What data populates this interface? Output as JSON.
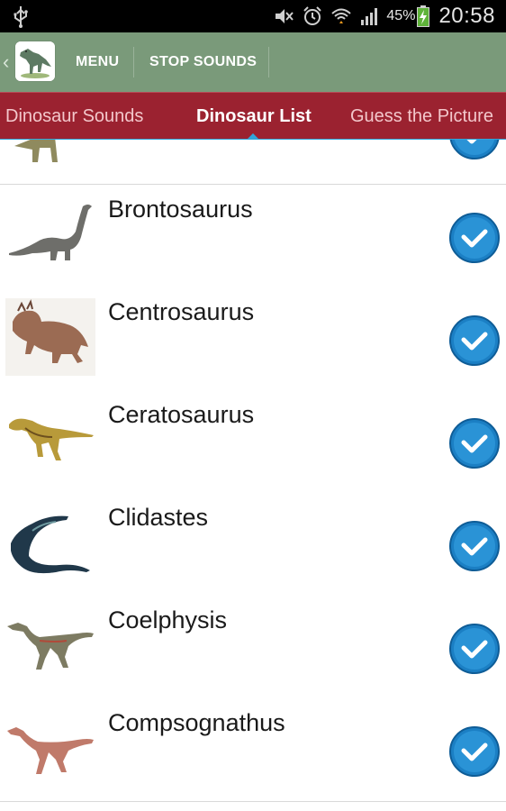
{
  "status_bar": {
    "battery_percent": "45%",
    "time": "20:58",
    "icons": [
      "usb-icon",
      "mute-icon",
      "alarm-icon",
      "wifi-icon",
      "signal-icon",
      "battery-charging-icon"
    ]
  },
  "action_bar": {
    "menu_label": "MENU",
    "stop_sounds_label": "STOP SOUNDS",
    "back_glyph": "‹"
  },
  "tabs": [
    {
      "label": "Dinosaur Sounds",
      "active": false
    },
    {
      "label": "Dinosaur List",
      "active": true
    },
    {
      "label": "Guess the Picture",
      "active": false
    }
  ],
  "list": {
    "items": [
      {
        "name": "",
        "checked": true
      },
      {
        "name": "Brontosaurus",
        "checked": true
      },
      {
        "name": "Centrosaurus",
        "checked": true
      },
      {
        "name": "Ceratosaurus",
        "checked": true
      },
      {
        "name": "Clidastes",
        "checked": true
      },
      {
        "name": "Coelphysis",
        "checked": true
      },
      {
        "name": "Compsognathus",
        "checked": true
      }
    ]
  },
  "colors": {
    "action_bar": "#7a9a7a",
    "tab_bar": "#9b2230",
    "tab_indicator": "#2fa6da",
    "check_blue": "#1b7fc4"
  }
}
